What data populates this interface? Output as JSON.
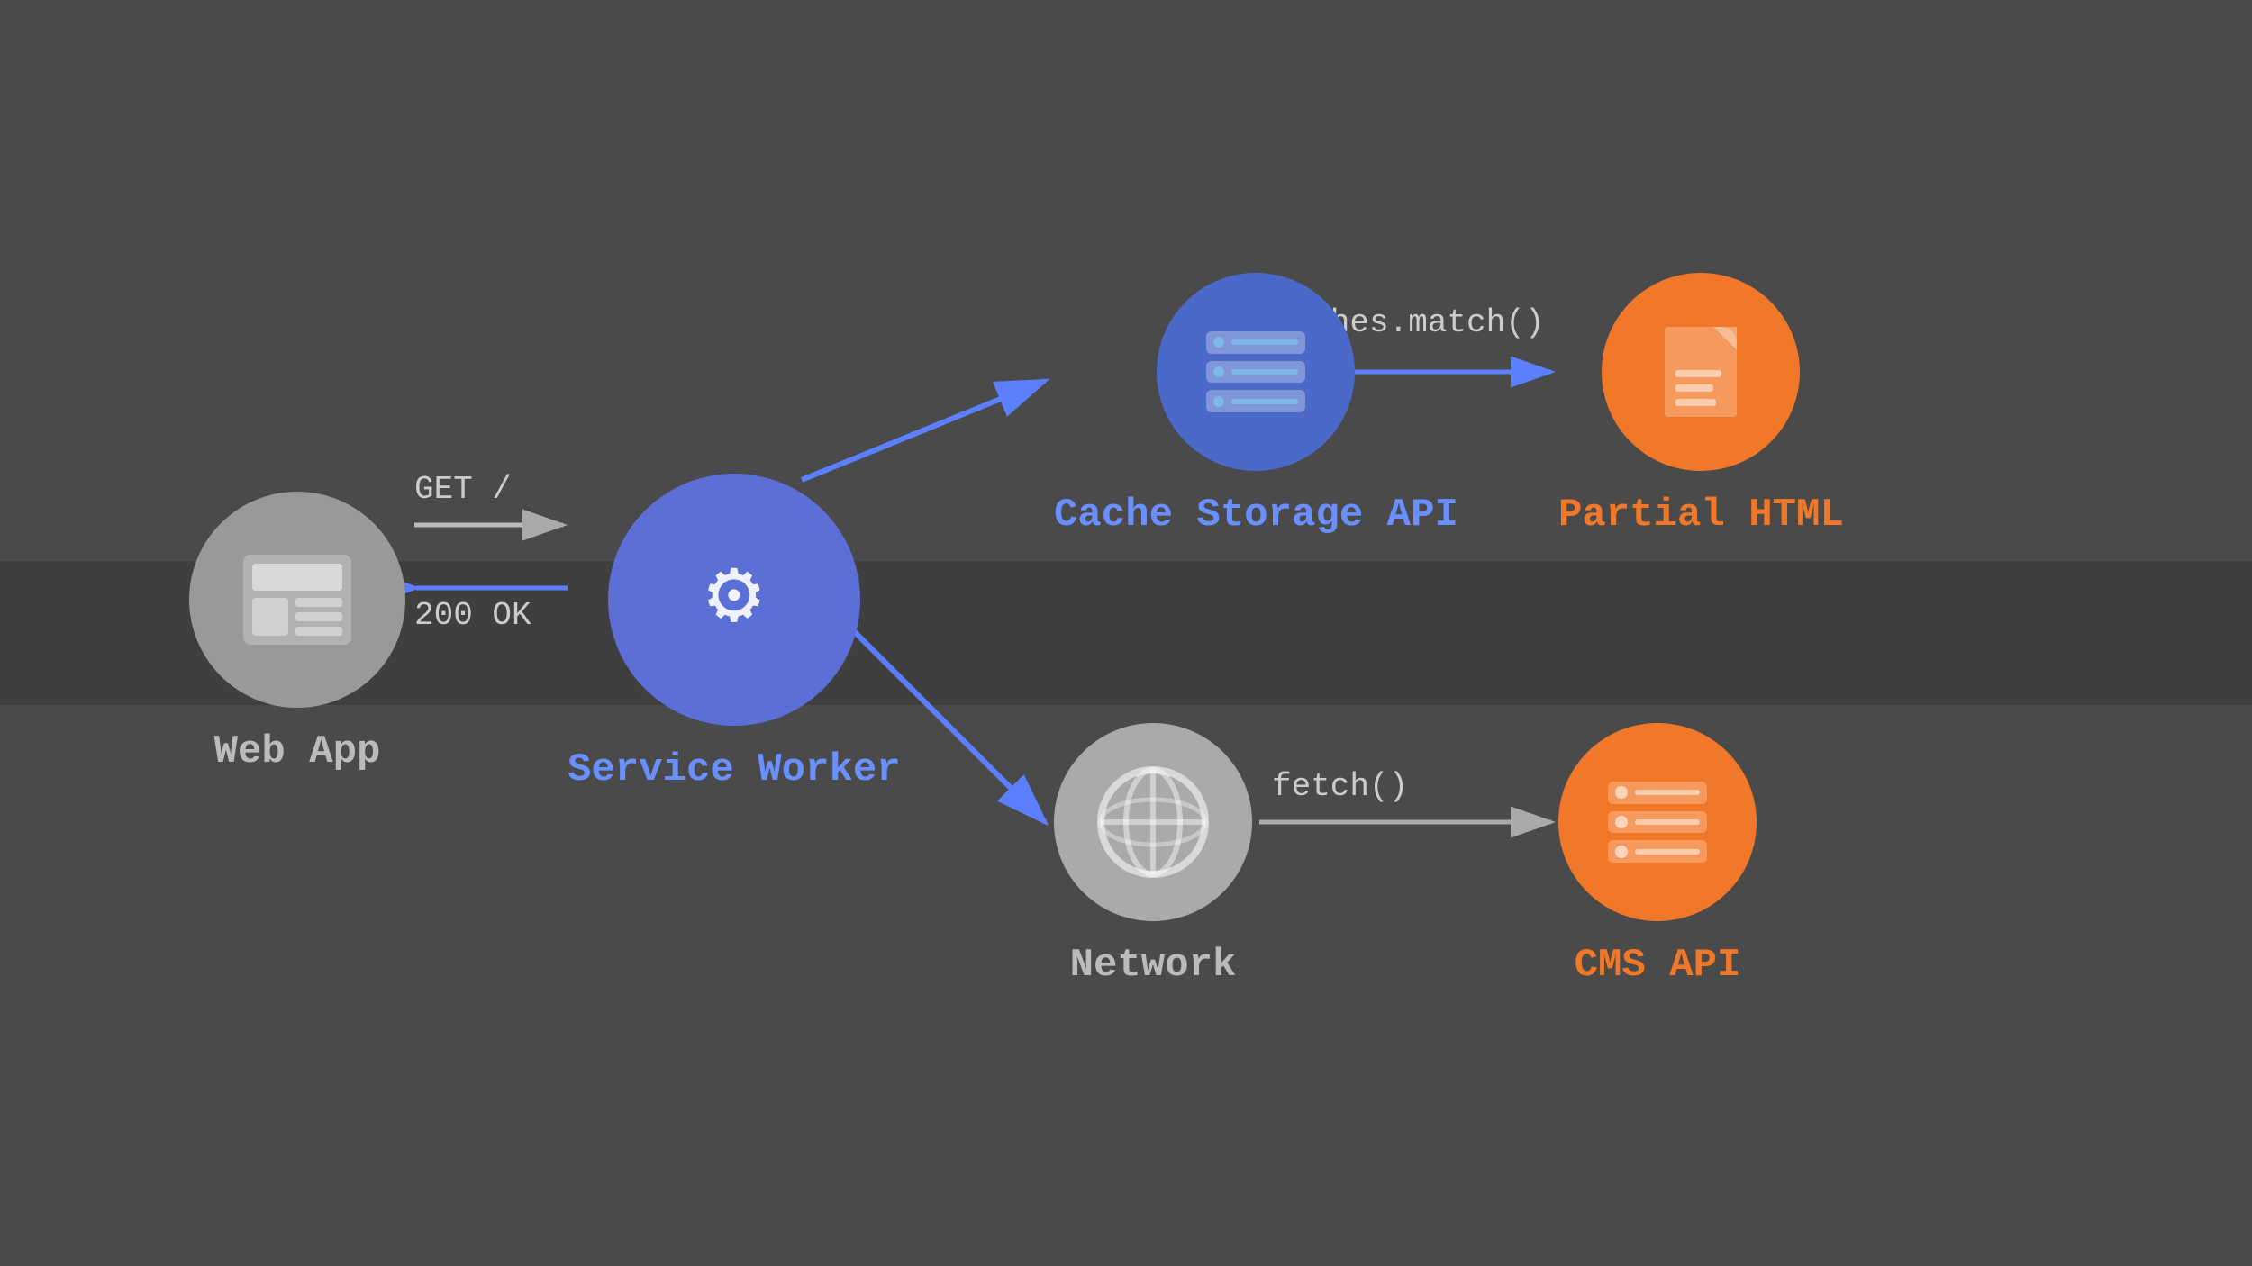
{
  "background": "#4a4a4a",
  "nodes": {
    "web_app": {
      "label": "Web App",
      "label_color": "label-gray"
    },
    "service_worker": {
      "label": "Service Worker",
      "label_color": "label-blue"
    },
    "cache_storage": {
      "label": "Cache Storage API",
      "label_color": "label-blue"
    },
    "network": {
      "label": "Network",
      "label_color": "label-gray"
    },
    "partial_html": {
      "label": "Partial HTML",
      "label_color": "label-orange"
    },
    "cms_api": {
      "label": "CMS API",
      "label_color": "label-orange"
    }
  },
  "arrows": {
    "get_label": "GET /",
    "ok_label": "200 OK",
    "caches_match_label": "caches.match()",
    "fetch_label": "fetch()"
  }
}
